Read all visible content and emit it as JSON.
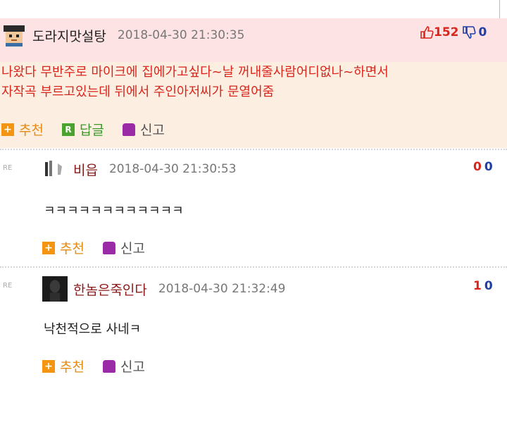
{
  "best": {
    "nickname": "도라지맛설탕",
    "date": "2018-04-30 21:30:35",
    "up": "152",
    "down": "0",
    "text_line1": "나왔다 무반주로 마이크에 집에가고싶다~날 꺼내줄사람어디없나~하면서",
    "text_line2": "자작곡 부르고있는데 뒤에서 주인아저씨가 문열어줌",
    "recommend": "추천",
    "reply": "답글",
    "report": "신고"
  },
  "replies": [
    {
      "re": "RE",
      "nickname": "비읍",
      "date": "2018-04-30 21:30:53",
      "up": "0",
      "down": "0",
      "text": "ㅋㅋㅋㅋㅋㅋㅋㅋㅋㅋㅋㅋ",
      "recommend": "추천",
      "report": "신고"
    },
    {
      "re": "RE",
      "nickname": "한놈은죽인다",
      "date": "2018-04-30 21:32:49",
      "up": "1",
      "down": "0",
      "text": "낙천적으로 사네ㅋ",
      "recommend": "추천",
      "report": "신고"
    }
  ],
  "icons": {
    "plus": "+",
    "reply_badge": "R",
    "thumb_up": "thumb-up-icon",
    "thumb_down": "thumb-down-icon",
    "siren": "siren-icon"
  },
  "colors": {
    "best_bg": "#fde3e3",
    "best_text": "#d8261c",
    "up_vote": "#d8261c",
    "down_vote": "#1f3ea8"
  }
}
